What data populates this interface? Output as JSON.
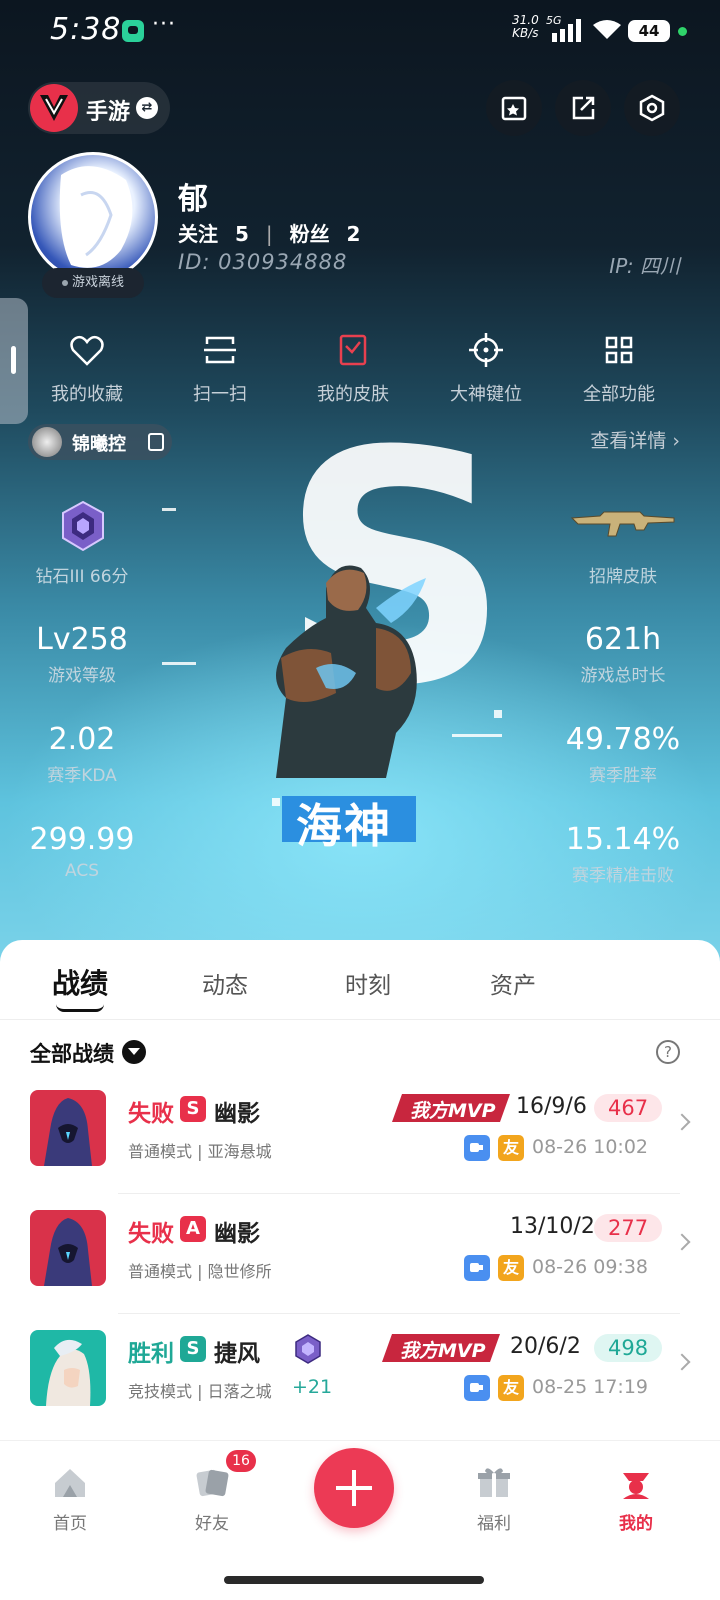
{
  "status_bar": {
    "time": "5:38",
    "dots": "···",
    "net_speed_value": "31.0",
    "net_speed_unit": "KB/s",
    "network": "5G",
    "battery": "44"
  },
  "top": {
    "game_label": "手游",
    "icons": [
      "game-logo-icon",
      "swap-icon",
      "edit-card-icon",
      "share-icon",
      "settings-icon"
    ]
  },
  "profile": {
    "status": "游戏离线",
    "name": "郁",
    "follow_label": "关注",
    "follow_count": "5",
    "fans_label": "粉丝",
    "fans_count": "2",
    "id": "ID: 030934888",
    "ip": "IP: 四川"
  },
  "quick_actions": [
    {
      "label": "我的收藏",
      "icon": "heart-icon"
    },
    {
      "label": "扫一扫",
      "icon": "scan-icon"
    },
    {
      "label": "我的皮肤",
      "icon": "skin-icon"
    },
    {
      "label": "大神键位",
      "icon": "crosshair-icon"
    },
    {
      "label": "全部功能",
      "icon": "grid-icon"
    }
  ],
  "card": {
    "tag_name": "锦曦控",
    "detail_link": "查看详情",
    "rank_label": "钻石III  66分",
    "skin_label": "招牌皮肤",
    "big_letter": "S",
    "agent_name": "海神",
    "stats": {
      "level": {
        "value": "Lv258",
        "label": "游戏等级"
      },
      "hours": {
        "value": "621h",
        "label": "游戏总时长"
      },
      "kda": {
        "value": "2.02",
        "label": "赛季KDA"
      },
      "winrate": {
        "value": "49.78%",
        "label": "赛季胜率"
      },
      "acs": {
        "value": "299.99",
        "label": "ACS"
      },
      "headshot": {
        "value": "15.14%",
        "label": "赛季精准击败"
      }
    }
  },
  "sheet": {
    "tabs": [
      "战绩",
      "动态",
      "时刻",
      "资产"
    ],
    "filter": "全部战绩",
    "matches": [
      {
        "result": "失败",
        "grade": "S",
        "agent": "幽影",
        "mode": "普通模式 | 亚海悬城",
        "mvp": "我方MVP",
        "kda": "16/9/6",
        "score": "467",
        "date": "08-26 10:02",
        "friend": "友"
      },
      {
        "result": "失败",
        "grade": "A",
        "agent": "幽影",
        "mode": "普通模式 | 隐世修所",
        "kda": "13/10/2",
        "score": "277",
        "date": "08-26 09:38",
        "friend": "友"
      },
      {
        "result": "胜利",
        "grade": "S",
        "agent": "捷风",
        "mode": "竞技模式 | 日落之城",
        "mvp": "我方MVP",
        "kda": "20/6/2",
        "score": "498",
        "date": "08-25 17:19",
        "rank_delta": "+21",
        "friend": "友"
      }
    ],
    "colors": {
      "loss": "#e8304a",
      "win": "#1fa896",
      "loss_bg": "#fde6e9",
      "win_bg": "#dff6f2"
    }
  },
  "nav": {
    "items": [
      {
        "label": "首页",
        "icon": "home-icon"
      },
      {
        "label": "好友",
        "icon": "friends-icon"
      },
      {
        "label": "福利",
        "icon": "gift-icon"
      },
      {
        "label": "我的",
        "icon": "profile-icon"
      }
    ],
    "friends_badge": "16",
    "accent": "#e8304a"
  }
}
